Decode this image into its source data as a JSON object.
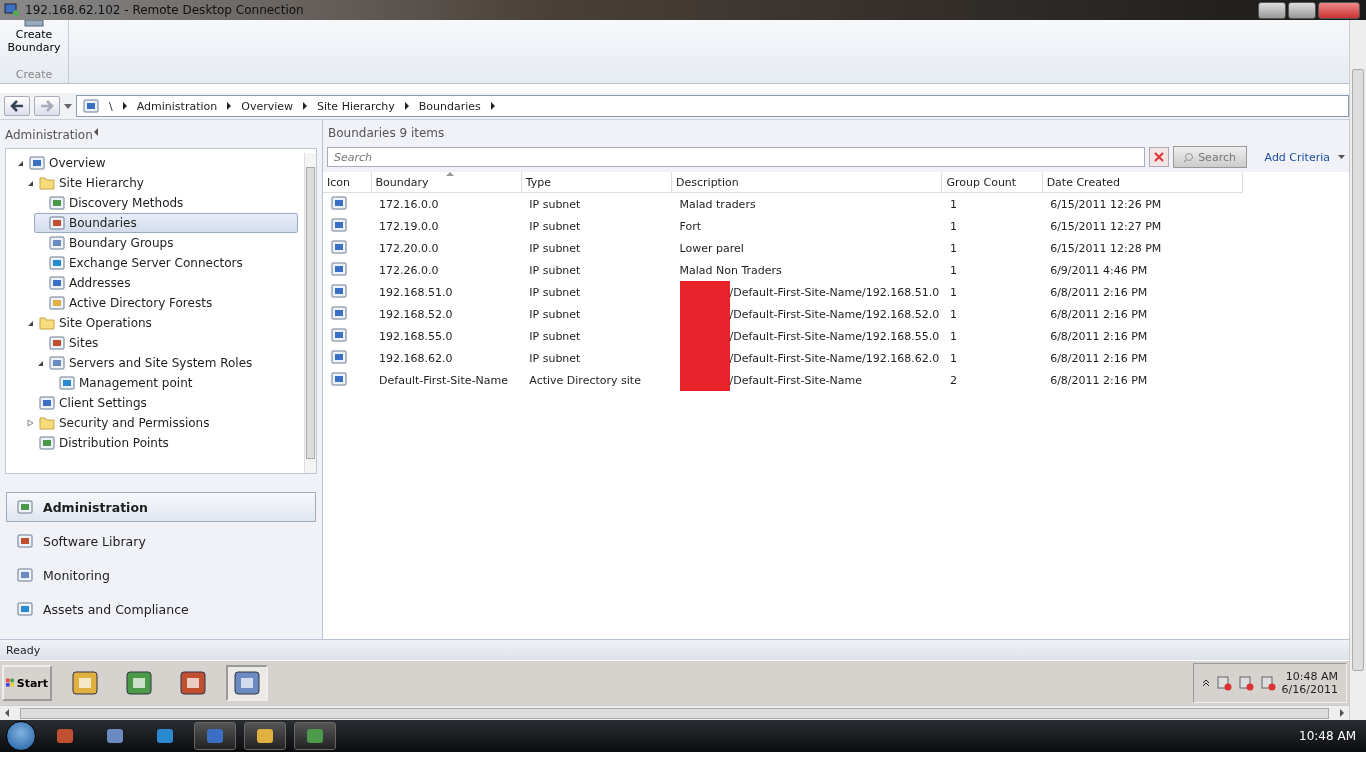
{
  "window": {
    "title": "192.168.62.102 - Remote Desktop Connection"
  },
  "ribbon": {
    "buttons": [
      {
        "label": "Create Boundary"
      }
    ],
    "group": "Create"
  },
  "breadcrumb": [
    "\\",
    "Administration",
    "Overview",
    "Site Hierarchy",
    "Boundaries"
  ],
  "navigation": {
    "title": "Administration",
    "tree": [
      {
        "label": "Overview",
        "expanded": true,
        "selected": false,
        "children": [
          {
            "label": "Site Hierarchy",
            "expanded": true,
            "selected": false,
            "children": [
              {
                "label": "Discovery Methods",
                "selected": false
              },
              {
                "label": "Boundaries",
                "selected": true
              },
              {
                "label": "Boundary Groups",
                "selected": false
              },
              {
                "label": "Exchange Server Connectors",
                "selected": false
              },
              {
                "label": "Addresses",
                "selected": false
              },
              {
                "label": "Active Directory Forests",
                "selected": false
              }
            ]
          },
          {
            "label": "Site Operations",
            "expanded": true,
            "selected": false,
            "children": [
              {
                "label": "Sites",
                "selected": false
              },
              {
                "label": "Servers and Site System Roles",
                "expanded": true,
                "selected": false,
                "children": [
                  {
                    "label": "Management point",
                    "selected": false
                  }
                ]
              }
            ]
          },
          {
            "label": "Client Settings",
            "selected": false
          },
          {
            "label": "Security and Permissions",
            "expanded": false,
            "selected": false
          },
          {
            "label": "Distribution Points",
            "selected": false
          }
        ]
      }
    ],
    "workspaces": [
      {
        "label": "Administration",
        "selected": true
      },
      {
        "label": "Software Library",
        "selected": false
      },
      {
        "label": "Monitoring",
        "selected": false
      },
      {
        "label": "Assets and Compliance",
        "selected": false
      }
    ]
  },
  "list": {
    "title": "Boundaries",
    "count": "9 items",
    "search": {
      "placeholder": "Search",
      "button": "Search"
    },
    "add_criteria": "Add Criteria",
    "columns": [
      {
        "label": "Icon",
        "sorted": false
      },
      {
        "label": "Boundary",
        "sorted": true
      },
      {
        "label": "Type",
        "sorted": false
      },
      {
        "label": "Description",
        "sorted": false
      },
      {
        "label": "Group Count",
        "sorted": false
      },
      {
        "label": "Date Created",
        "sorted": false
      }
    ],
    "rows": [
      {
        "boundary": "172.16.0.0",
        "type": "IP subnet",
        "description": "Malad traders",
        "redacted": false,
        "group_count": "1",
        "date_created": "6/15/2011 12:26 PM"
      },
      {
        "boundary": "172.19.0.0",
        "type": "IP subnet",
        "description": "Fort",
        "redacted": false,
        "group_count": "1",
        "date_created": "6/15/2011 12:27 PM"
      },
      {
        "boundary": "172.20.0.0",
        "type": "IP subnet",
        "description": "Lower parel",
        "redacted": false,
        "group_count": "1",
        "date_created": "6/15/2011 12:28 PM"
      },
      {
        "boundary": "172.26.0.0",
        "type": "IP subnet",
        "description": "Malad Non Traders",
        "redacted": false,
        "group_count": "1",
        "date_created": "6/9/2011 4:46 PM"
      },
      {
        "boundary": "192.168.51.0",
        "type": "IP subnet",
        "description": "/Default-First-Site-Name/192.168.51.0",
        "redacted": true,
        "group_count": "1",
        "date_created": "6/8/2011 2:16 PM"
      },
      {
        "boundary": "192.168.52.0",
        "type": "IP subnet",
        "description": "/Default-First-Site-Name/192.168.52.0",
        "redacted": true,
        "group_count": "1",
        "date_created": "6/8/2011 2:16 PM"
      },
      {
        "boundary": "192.168.55.0",
        "type": "IP subnet",
        "description": "/Default-First-Site-Name/192.168.55.0",
        "redacted": true,
        "group_count": "1",
        "date_created": "6/8/2011 2:16 PM"
      },
      {
        "boundary": "192.168.62.0",
        "type": "IP subnet",
        "description": "/Default-First-Site-Name/192.168.62.0",
        "redacted": true,
        "group_count": "1",
        "date_created": "6/8/2011 2:16 PM"
      },
      {
        "boundary": "Default-First-Site-Name",
        "type": "Active Directory site",
        "description": "/Default-First-Site-Name",
        "redacted": true,
        "group_count": "2",
        "date_created": "6/8/2011 2:16 PM"
      }
    ]
  },
  "status_bar": "Ready",
  "remote_taskbar": {
    "start": "Start",
    "apps": [
      {
        "selected": false
      },
      {
        "selected": false
      },
      {
        "selected": false
      },
      {
        "selected": true
      }
    ],
    "time": "10:48 AM",
    "date": "6/16/2011"
  },
  "host_taskbar": {
    "apps": [
      {
        "selected": false
      },
      {
        "selected": false
      },
      {
        "selected": false
      },
      {
        "selected": true
      },
      {
        "selected": true
      },
      {
        "selected": true
      }
    ],
    "time": "10:48 AM"
  }
}
